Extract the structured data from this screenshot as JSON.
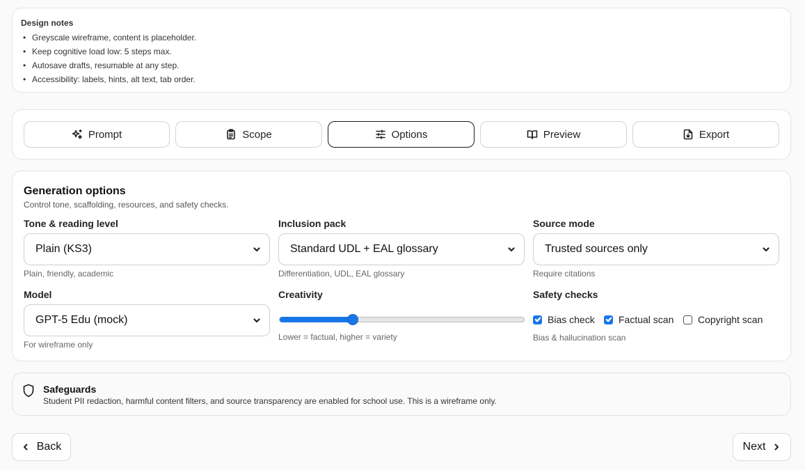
{
  "notes": {
    "title": "Design notes",
    "items": [
      "Greyscale wireframe, content is placeholder.",
      "Keep cognitive load low: 5 steps max.",
      "Autosave drafts, resumable at any step.",
      "Accessibility: labels, hints, alt text, tab order."
    ]
  },
  "steps": [
    {
      "label": "Prompt",
      "icon": "sparkles-icon"
    },
    {
      "label": "Scope",
      "icon": "clipboard-icon"
    },
    {
      "label": "Options",
      "icon": "sliders-icon",
      "active": true
    },
    {
      "label": "Preview",
      "icon": "book-open-icon"
    },
    {
      "label": "Export",
      "icon": "file-download-icon"
    }
  ],
  "generation": {
    "title": "Generation options",
    "subtitle": "Control tone, scaffolding, resources, and safety checks.",
    "tone": {
      "label": "Tone & reading level",
      "value": "Plain (KS3)",
      "hint": "Plain, friendly, academic"
    },
    "inclusion": {
      "label": "Inclusion pack",
      "value": "Standard UDL + EAL glossary",
      "hint": "Differentiation, UDL, EAL glossary"
    },
    "source": {
      "label": "Source mode",
      "value": "Trusted sources only",
      "hint": "Require citations"
    },
    "model": {
      "label": "Model",
      "value": "GPT-5 Edu (mock)",
      "hint": "For wireframe only"
    },
    "creativity": {
      "label": "Creativity",
      "value": 0.3,
      "hint": "Lower = factual, higher = variety"
    },
    "safety": {
      "label": "Safety checks",
      "hint": "Bias & hallucination scan",
      "checks": [
        {
          "label": "Bias check",
          "checked": true
        },
        {
          "label": "Factual scan",
          "checked": true
        },
        {
          "label": "Copyright scan",
          "checked": false
        }
      ]
    }
  },
  "safeguards": {
    "title": "Safeguards",
    "text": "Student PII redaction, harmful content filters, and source transparency are enabled for school use. This is a wireframe only."
  },
  "nav": {
    "back": "Back",
    "next": "Next"
  },
  "colors": {
    "accent": "#1976e8",
    "border": "#e3e3e3"
  }
}
